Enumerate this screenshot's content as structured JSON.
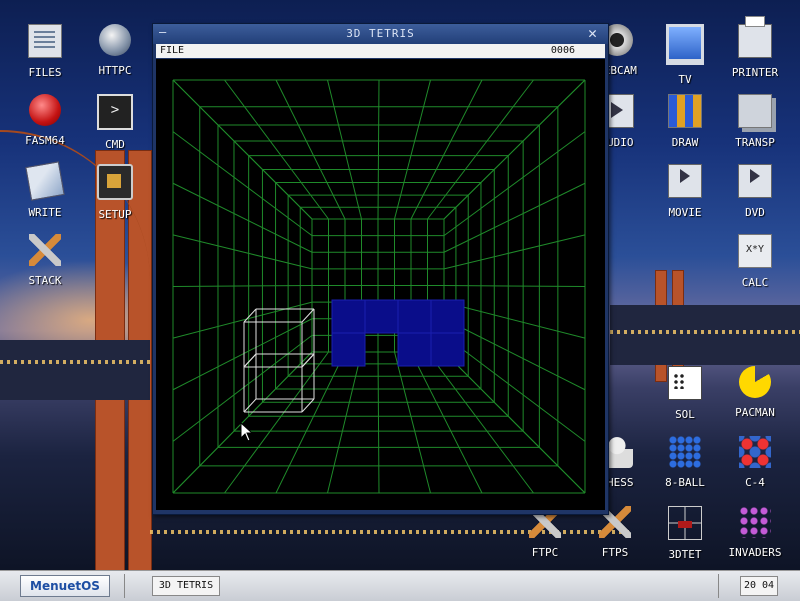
{
  "desktop": {
    "icons": [
      {
        "label": "FILES",
        "icon": "files-icon"
      },
      {
        "label": "HTTPC",
        "icon": "httpc-icon"
      },
      {
        "label": "FASM64",
        "icon": "fasm-icon"
      },
      {
        "label": "CMD",
        "icon": "cmd-icon"
      },
      {
        "label": "WRITE",
        "icon": "write-icon"
      },
      {
        "label": "SETUP",
        "icon": "setup-icon"
      },
      {
        "label": "STACK",
        "icon": "stack-icon"
      },
      {
        "label": "WEBCAM",
        "icon": "webcam-icon"
      },
      {
        "label": "TV",
        "icon": "tv-icon"
      },
      {
        "label": "PRINTER",
        "icon": "printer-icon"
      },
      {
        "label": "AUDIO",
        "icon": "audio-icon"
      },
      {
        "label": "DRAW",
        "icon": "draw-icon"
      },
      {
        "label": "TRANSP",
        "icon": "transp-icon"
      },
      {
        "label": "MOVIE",
        "icon": "movie-icon"
      },
      {
        "label": "DVD",
        "icon": "dvd-icon"
      },
      {
        "label": "CALC",
        "icon": "calc-icon",
        "glyph": "X*Y"
      },
      {
        "label": "SOL",
        "icon": "sol-icon"
      },
      {
        "label": "PACMAN",
        "icon": "pacman-icon"
      },
      {
        "label": "CHESS",
        "icon": "chess-icon"
      },
      {
        "label": "8-BALL",
        "icon": "8ball-icon"
      },
      {
        "label": "C-4",
        "icon": "c4-icon"
      },
      {
        "label": "FTPC",
        "icon": "ftpc-icon"
      },
      {
        "label": "FTPS",
        "icon": "ftps-icon"
      },
      {
        "label": "3DTET",
        "icon": "3dtet-icon"
      },
      {
        "label": "INVADERS",
        "icon": "invaders-icon"
      }
    ]
  },
  "window": {
    "title": "3D TETRIS",
    "minimize_glyph": "—",
    "close_glyph": "✕",
    "menu_file": "FILE",
    "score": "0006",
    "grid_color": "#1f8a2a",
    "block_color": "#0a0d8a",
    "ghost_color": "#e0e0e0"
  },
  "taskbar": {
    "start_label": "MenuetOS",
    "task_label": "3D TETRIS",
    "clock": "20 04"
  },
  "cmd_glyph": ">"
}
